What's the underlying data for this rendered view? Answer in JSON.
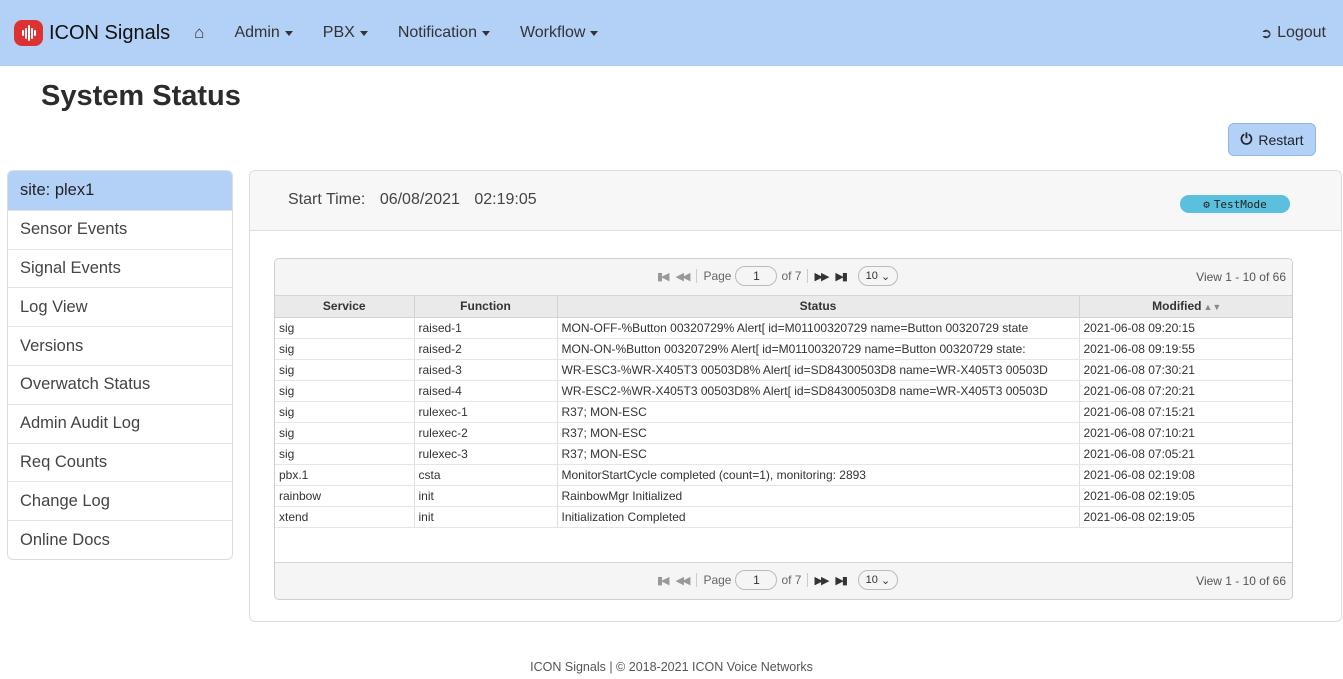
{
  "brand": {
    "name": "ICON Signals"
  },
  "nav": {
    "items": [
      {
        "label": "Admin"
      },
      {
        "label": "PBX"
      },
      {
        "label": "Notification"
      },
      {
        "label": "Workflow"
      }
    ],
    "logout_label": "Logout"
  },
  "page": {
    "title": "System Status"
  },
  "restart_label": "Restart",
  "sidebar": {
    "items": [
      {
        "label": "site: plex1"
      },
      {
        "label": "Sensor Events"
      },
      {
        "label": "Signal Events"
      },
      {
        "label": "Log View"
      },
      {
        "label": "Versions"
      },
      {
        "label": "Overwatch Status"
      },
      {
        "label": "Admin Audit Log"
      },
      {
        "label": "Req Counts"
      },
      {
        "label": "Change Log"
      },
      {
        "label": "Online Docs"
      }
    ]
  },
  "status": {
    "start_label": "Start Time:",
    "start_date": "06/08/2021",
    "start_time": "02:19:05",
    "testmode_label": "TestMode"
  },
  "grid": {
    "pager": {
      "page_label": "Page",
      "page_value": "1",
      "of_label": "of 7",
      "rows_value": "10",
      "view_label": "View 1 - 10 of 66"
    },
    "columns": [
      "Service",
      "Function",
      "Status",
      "Modified"
    ],
    "rows": [
      [
        "sig",
        "raised-1",
        "MON-OFF-%Button 00320729% Alert[ id=M01100320729 name=Button 00320729 state",
        "2021-06-08 09:20:15"
      ],
      [
        "sig",
        "raised-2",
        "MON-ON-%Button 00320729% Alert[ id=M01100320729 name=Button 00320729 state:",
        "2021-06-08 09:19:55"
      ],
      [
        "sig",
        "raised-3",
        "WR-ESC3-%WR-X405T3 00503D8% Alert[ id=SD84300503D8 name=WR-X405T3 00503D",
        "2021-06-08 07:30:21"
      ],
      [
        "sig",
        "raised-4",
        "WR-ESC2-%WR-X405T3 00503D8% Alert[ id=SD84300503D8 name=WR-X405T3 00503D",
        "2021-06-08 07:20:21"
      ],
      [
        "sig",
        "rulexec-1",
        "R37; MON-ESC",
        "2021-06-08 07:15:21"
      ],
      [
        "sig",
        "rulexec-2",
        "R37; MON-ESC",
        "2021-06-08 07:10:21"
      ],
      [
        "sig",
        "rulexec-3",
        "R37; MON-ESC",
        "2021-06-08 07:05:21"
      ],
      [
        "pbx.1",
        "csta",
        "MonitorStartCycle completed (count=1), monitoring: 2893",
        "2021-06-08 02:19:08"
      ],
      [
        "rainbow",
        "init",
        "RainbowMgr Initialized",
        "2021-06-08 02:19:05"
      ],
      [
        "xtend",
        "init",
        "Initialization Completed",
        "2021-06-08 02:19:05"
      ]
    ]
  },
  "footer": {
    "text": "ICON Signals | © 2018-2021 ICON Voice Networks"
  }
}
